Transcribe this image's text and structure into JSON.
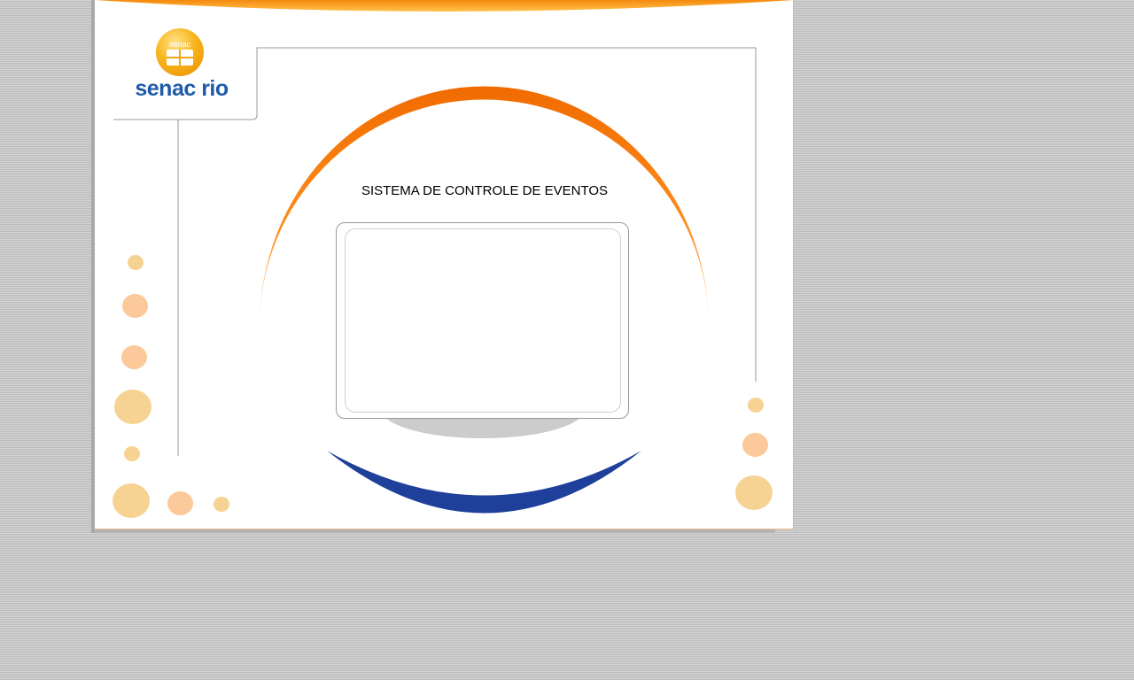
{
  "logo": {
    "badge_text": "senac",
    "wordmark": "senac rio"
  },
  "main": {
    "title": "SISTEMA DE CONTROLE DE EVENTOS"
  },
  "colors": {
    "background": "#c9c9c9",
    "panel": "#ffffff",
    "orange_arc": "#f37a10",
    "blue_arc": "#1e3f9a",
    "gray_shadow": "#cccccc",
    "dot_yellow": "#f6d393",
    "dot_peach": "#fbc99a",
    "logo_blue": "#1f5ba8"
  }
}
